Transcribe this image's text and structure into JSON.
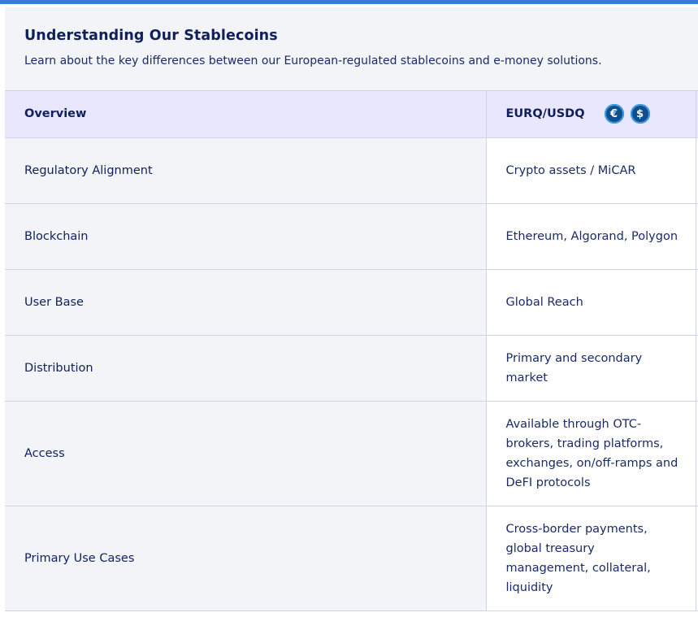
{
  "intro": {
    "title": "Understanding Our Stablecoins",
    "subtitle": "Learn about the key differences between our European-regulated stablecoins and e-money solutions."
  },
  "table": {
    "header": {
      "overview_label": "Overview",
      "column_label": "EURQ/USDQ",
      "icons": [
        {
          "name": "euro-coin-icon",
          "glyph": "€"
        },
        {
          "name": "dollar-coin-icon",
          "glyph": "$"
        }
      ]
    },
    "rows": [
      {
        "label": "Regulatory Alignment",
        "value": "Crypto assets / MiCAR"
      },
      {
        "label": "Blockchain",
        "value": "Ethereum, Algorand, Polygon"
      },
      {
        "label": "User Base",
        "value": "Global Reach"
      },
      {
        "label": "Distribution",
        "value": "Primary and secondary market"
      },
      {
        "label": "Access",
        "value": "Available through OTC-brokers, trading platforms, exchanges, on/off-ramps and DeFI protocols"
      },
      {
        "label": "Primary Use Cases",
        "value": "Cross-border payments, global treasury management, collateral, liquidity"
      }
    ]
  },
  "colors": {
    "accent_bar": "#3a7be0",
    "header_bg": "#e9e7fd",
    "label_bg": "#f3f4f7",
    "text": "#0f1f5c",
    "coin": "#0f4f8f"
  }
}
